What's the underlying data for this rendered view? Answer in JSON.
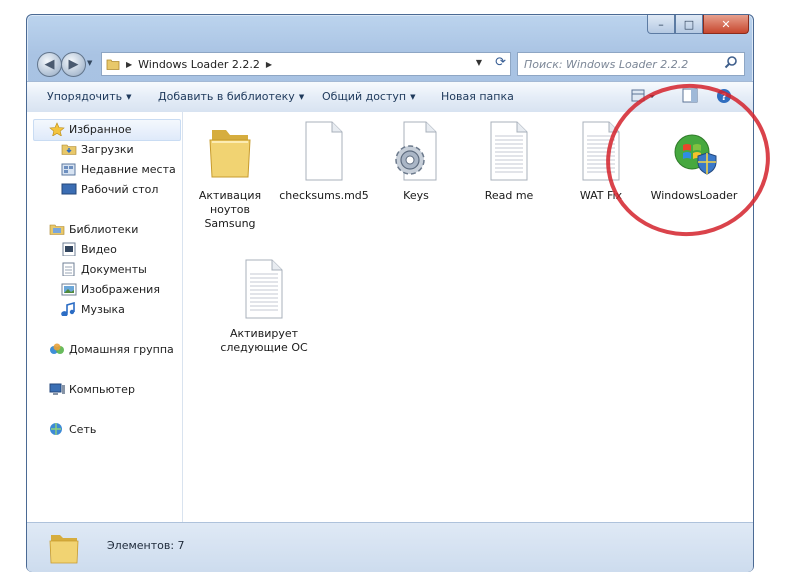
{
  "window": {
    "caption_buttons": {
      "minimize": "–",
      "maximize": "□",
      "close": "✕"
    }
  },
  "address_bar": {
    "crumbs": [
      "Windows Loader 2.2.2"
    ],
    "search_placeholder": "Поиск: Windows Loader 2.2.2"
  },
  "toolbar": {
    "organize": "Упорядочить",
    "add_library": "Добавить в библиотеку",
    "share": "Общий доступ",
    "new_folder": "Новая папка"
  },
  "nav": {
    "favorites": "Избранное",
    "downloads": "Загрузки",
    "recent": "Недавние места",
    "desktop": "Рабочий стол",
    "libraries": "Библиотеки",
    "video": "Видео",
    "documents": "Документы",
    "images": "Изображения",
    "music": "Музыка",
    "homegroup": "Домашняя группа",
    "computer": "Компьютер",
    "network": "Сеть"
  },
  "files": [
    {
      "name": "Активация ноутов Samsung",
      "type": "folder"
    },
    {
      "name": "checksums.md5",
      "type": "document"
    },
    {
      "name": "Keys",
      "type": "settings"
    },
    {
      "name": "Read me",
      "type": "text"
    },
    {
      "name": "WAT Fix",
      "type": "text"
    },
    {
      "name": "WindowsLoader",
      "type": "exe"
    },
    {
      "name": "Активирует следующие ОС",
      "type": "document"
    }
  ],
  "status": {
    "count_text": "Элементов: 7"
  },
  "colors": {
    "annotation_ring": "#d4222b",
    "chrome": "#a9c3e3"
  }
}
